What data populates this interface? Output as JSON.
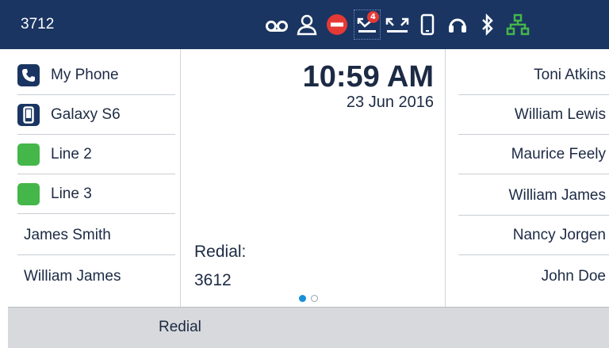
{
  "status_bar": {
    "extension": "3712",
    "icons": [
      {
        "name": "voicemail-icon"
      },
      {
        "name": "presence-icon"
      },
      {
        "name": "dnd-icon"
      },
      {
        "name": "missed-calls-icon",
        "badge": "4"
      },
      {
        "name": "call-forward-icon"
      },
      {
        "name": "mobile-device-icon"
      },
      {
        "name": "headset-icon"
      },
      {
        "name": "bluetooth-icon"
      },
      {
        "name": "network-icon"
      }
    ],
    "colors": {
      "background": "#1a3562",
      "dnd": "#e53935",
      "network": "#45b649"
    }
  },
  "line_keys": [
    {
      "label": "My Phone",
      "icon": "phone-icon"
    },
    {
      "label": "Galaxy S6",
      "icon": "mobile-phone-icon"
    },
    {
      "label": "Line 2",
      "icon": "line-status-green"
    },
    {
      "label": "Line 3",
      "icon": "line-status-green"
    },
    {
      "label": "James Smith"
    },
    {
      "label": "William James"
    }
  ],
  "idle": {
    "time": "10:59 AM",
    "date": "23 Jun 2016",
    "redial_label": "Redial:",
    "redial_number": "3612",
    "page_indicator": {
      "current": 1,
      "total": 2
    }
  },
  "favorites": [
    "Toni Atkins",
    "William Lewis",
    "Maurice Feely",
    "William James",
    "Nancy Jorgen",
    "John Doe"
  ],
  "softkeys": [
    "Redial"
  ]
}
